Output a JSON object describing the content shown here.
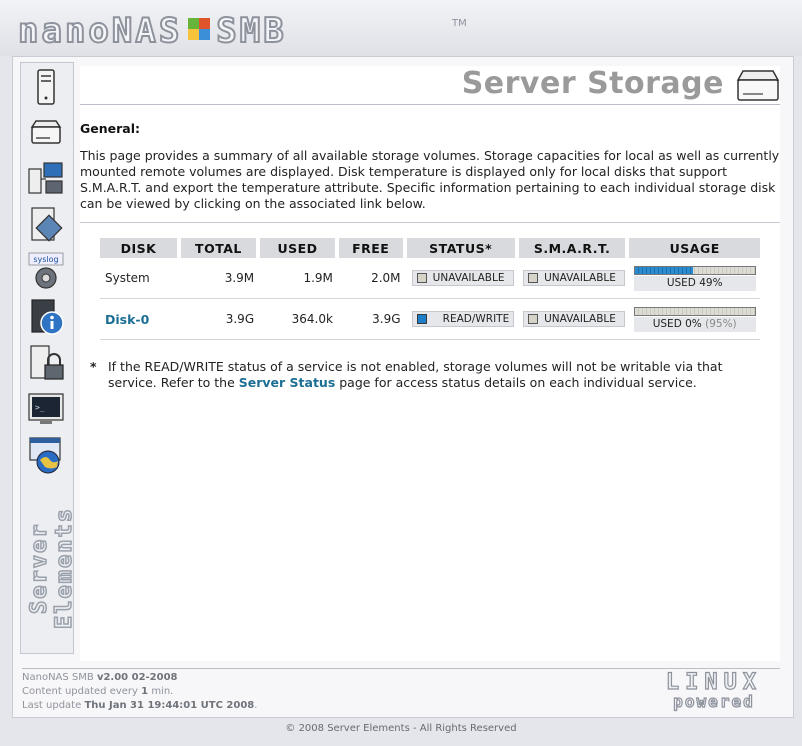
{
  "brand": {
    "logo_left": "nanoNAS",
    "logo_right": "SMB",
    "trademark": "TM"
  },
  "page": {
    "title": "Server Storage"
  },
  "sidebar": {
    "items": [
      {
        "name": "server-icon",
        "label": ""
      },
      {
        "name": "storage-icon",
        "label": ""
      },
      {
        "name": "network-icon",
        "label": ""
      },
      {
        "name": "diagnostics-icon",
        "label": ""
      },
      {
        "name": "syslog-icon",
        "label": "syslog"
      },
      {
        "name": "info-icon",
        "label": ""
      },
      {
        "name": "security-icon",
        "label": ""
      },
      {
        "name": "terminal-icon",
        "label": ""
      },
      {
        "name": "web-icon",
        "label": ""
      }
    ],
    "brand_text": "Server Elements"
  },
  "general": {
    "heading": "General:",
    "description": "This page provides a summary of all available storage volumes. Storage capacities for local as well as currently mounted remote volumes are displayed. Disk temperature is displayed only for local disks that support S.M.A.R.T. and export the temperature attribute. Specific information pertaining to each individual storage disk can be viewed by clicking on the associated link below."
  },
  "table": {
    "headers": [
      "DISK",
      "TOTAL",
      "USED",
      "FREE",
      "STATUS*",
      "S.M.A.R.T.",
      "USAGE"
    ],
    "rows": [
      {
        "disk": "System",
        "link": false,
        "total": "3.9M",
        "used": "1.9M",
        "free": "2.0M",
        "status": "UNAVAILABLE",
        "status_kind": "unavailable",
        "smart": "UNAVAILABLE",
        "usage_fraction": 0.49,
        "usage_label": "USED 49%",
        "usage_extra": ""
      },
      {
        "disk": "Disk-0",
        "link": true,
        "total": "3.9G",
        "used": "364.0k",
        "free": "3.9G",
        "status": "READ/WRITE",
        "status_kind": "readwrite",
        "smart": "UNAVAILABLE",
        "usage_fraction": 0.0,
        "usage_label": "USED 0%",
        "usage_extra": "(95%)"
      }
    ]
  },
  "note": {
    "star": "*",
    "text_before": "If the READ/WRITE status of a service is not enabled, storage volumes will not be writable via that service. Refer to the ",
    "link": "Server Status",
    "text_after": " page for access status details on each individual service."
  },
  "footer": {
    "product": "NanoNAS SMB",
    "version": "v2.00 02-2008",
    "content_prefix": "Content updated every",
    "content_interval": "1",
    "content_suffix": "min.",
    "last_update_prefix": "Last update",
    "last_update": "Thu Jan 31 19:44:01 UTC 2008",
    "copyright": "© 2008 Server Elements - All Rights Reserved",
    "linux_line1": "LINUX",
    "linux_line2": "powered"
  },
  "colors": {
    "link": "#1c6f94",
    "usage_fill": "#2b8bd0",
    "rw_indicator": "#1a7ec8"
  }
}
